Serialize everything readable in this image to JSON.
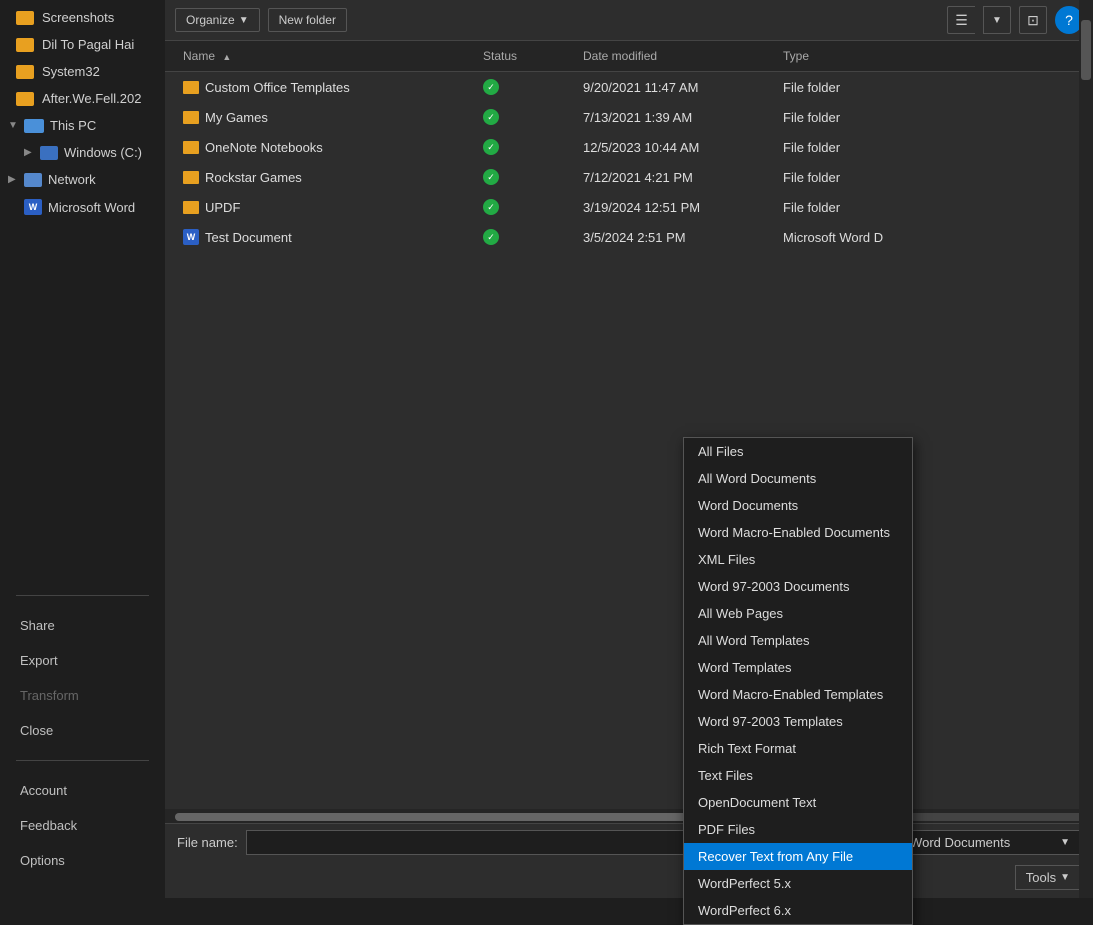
{
  "toolbar": {
    "organize_label": "Organize",
    "new_folder_label": "New folder",
    "view_icon": "☰",
    "help_icon": "?"
  },
  "file_header": {
    "name": "Name",
    "status": "Status",
    "date_modified": "Date modified",
    "type": "Type"
  },
  "files": [
    {
      "name": "Custom Office Templates",
      "status": "✓",
      "date": "9/20/2021 11:47 AM",
      "type": "File folder",
      "kind": "folder"
    },
    {
      "name": "My Games",
      "status": "✓",
      "date": "7/13/2021 1:39 AM",
      "type": "File folder",
      "kind": "folder"
    },
    {
      "name": "OneNote Notebooks",
      "status": "✓",
      "date": "12/5/2023 10:44 AM",
      "type": "File folder",
      "kind": "folder"
    },
    {
      "name": "Rockstar Games",
      "status": "✓",
      "date": "7/12/2021 4:21 PM",
      "type": "File folder",
      "kind": "folder"
    },
    {
      "name": "UPDF",
      "status": "✓",
      "date": "3/19/2024 12:51 PM",
      "type": "File folder",
      "kind": "folder"
    },
    {
      "name": "Test Document",
      "status": "✓",
      "date": "3/5/2024 2:51 PM",
      "type": "Microsoft Word D",
      "kind": "word"
    }
  ],
  "sidebar": {
    "top_items": [
      {
        "label": "Screenshots",
        "kind": "folder"
      },
      {
        "label": "Dil To Pagal Hai",
        "kind": "folder"
      },
      {
        "label": "System32",
        "kind": "folder"
      },
      {
        "label": "After.We.Fell.202",
        "kind": "folder"
      }
    ],
    "this_pc": "This PC",
    "windows_c": "Windows (C:)",
    "network": "Network",
    "microsoft_word": "Microsoft Word"
  },
  "bottom_nav": {
    "share": "Share",
    "export": "Export",
    "transform": "Transform",
    "close": "Close",
    "account": "Account",
    "feedback": "Feedback",
    "options": "Options"
  },
  "bottom_bar": {
    "filename_label": "File name:",
    "filetype_label": "All Word Documents",
    "tools_label": "Tools"
  },
  "dropdown": {
    "items": [
      {
        "label": "All Files",
        "selected": false
      },
      {
        "label": "All Word Documents",
        "selected": false
      },
      {
        "label": "Word Documents",
        "selected": false
      },
      {
        "label": "Word Macro-Enabled Documents",
        "selected": false
      },
      {
        "label": "XML Files",
        "selected": false
      },
      {
        "label": "Word 97-2003 Documents",
        "selected": false
      },
      {
        "label": "All Web Pages",
        "selected": false
      },
      {
        "label": "All Word Templates",
        "selected": false
      },
      {
        "label": "Word Templates",
        "selected": false
      },
      {
        "label": "Word Macro-Enabled Templates",
        "selected": false
      },
      {
        "label": "Word 97-2003 Templates",
        "selected": false
      },
      {
        "label": "Rich Text Format",
        "selected": false
      },
      {
        "label": "Text Files",
        "selected": false
      },
      {
        "label": "OpenDocument Text",
        "selected": false
      },
      {
        "label": "PDF Files",
        "selected": false
      },
      {
        "label": "Recover Text from Any File",
        "selected": true
      },
      {
        "label": "WordPerfect 5.x",
        "selected": false
      },
      {
        "label": "WordPerfect 6.x",
        "selected": false
      }
    ]
  }
}
